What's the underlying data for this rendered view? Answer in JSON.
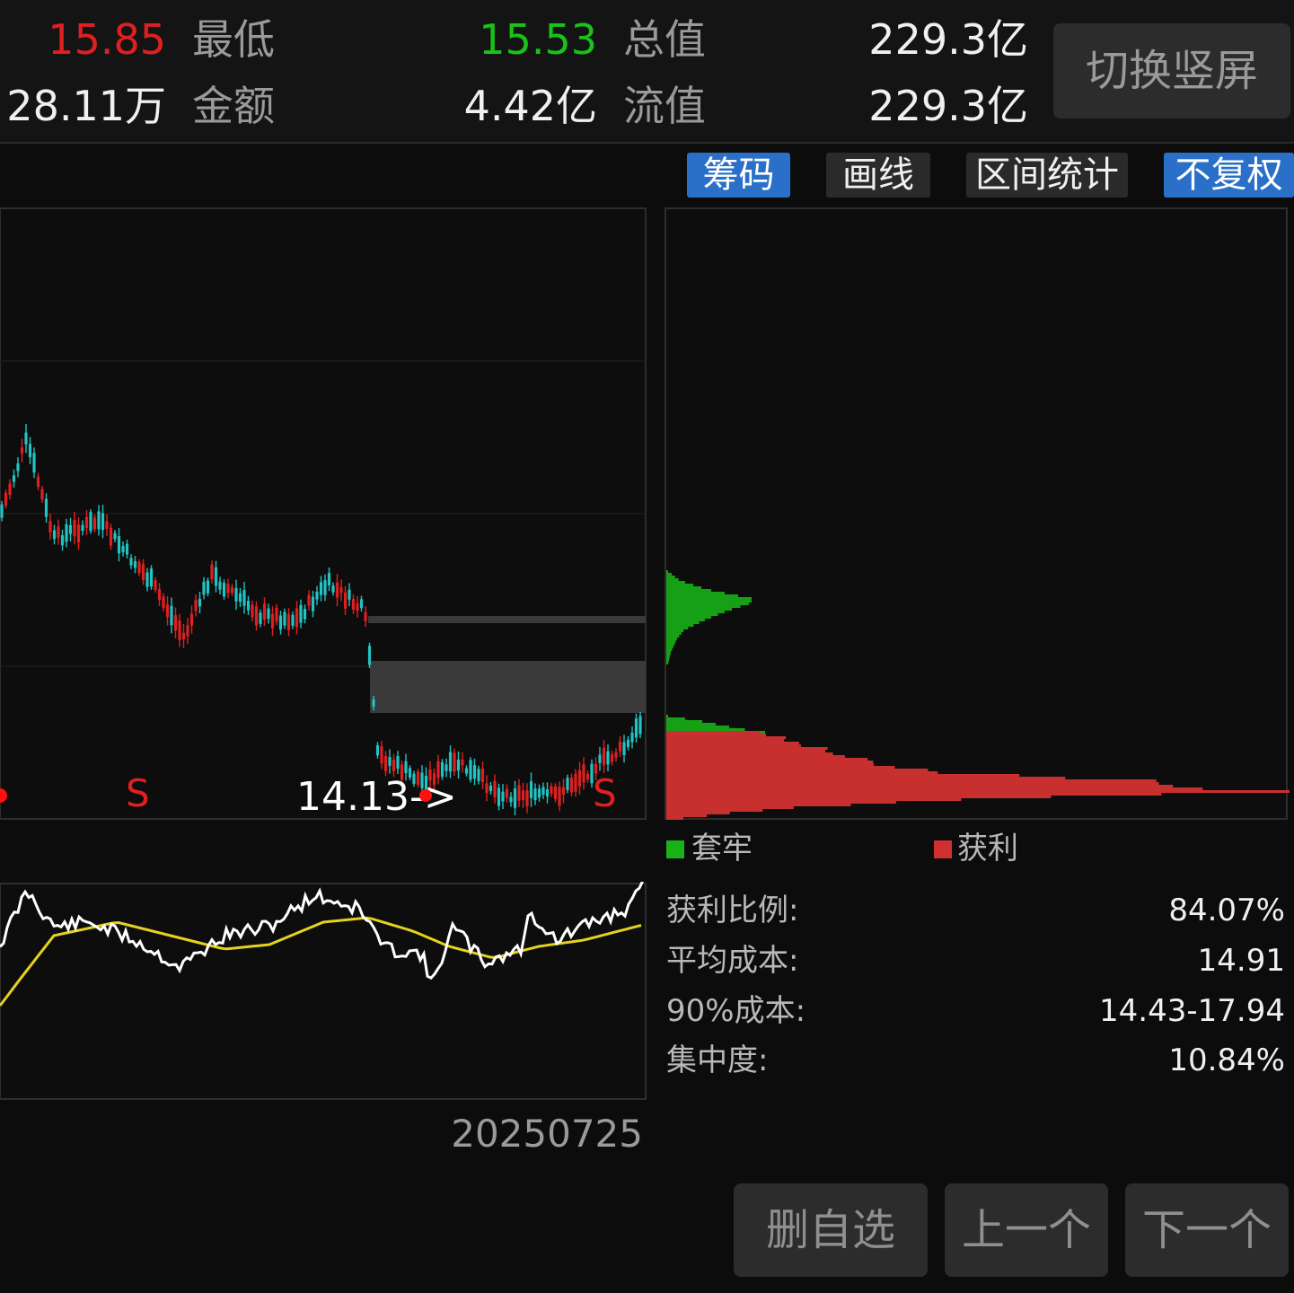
{
  "quote": {
    "row1": {
      "v1": "15.85",
      "l1": "最低",
      "v2": "15.53",
      "l2": "总值",
      "v3": "229.3亿"
    },
    "row2": {
      "v1": "28.11万",
      "l1": "金额",
      "v2": "4.42亿",
      "l2": "流值",
      "v3": "229.3亿"
    }
  },
  "switch_label": "切换竖屏",
  "toolbar": {
    "chips": "筹码",
    "draw": "画线",
    "range": "区间统计",
    "adjust": "不复权"
  },
  "kline": {
    "markers": {
      "s1": "S",
      "s2": "S",
      "price_tag": "14.13->"
    },
    "date": "20250725"
  },
  "legend": {
    "trapped": "套牢",
    "profit": "获利"
  },
  "stats": {
    "profit_ratio": {
      "label": "获利比例:",
      "value": "84.07%"
    },
    "avg_cost": {
      "label": "平均成本:",
      "value": "14.91"
    },
    "cost90": {
      "label": "90%成本:",
      "value": "14.43-17.94"
    },
    "concentration": {
      "label": "集中度:",
      "value": "10.84%"
    }
  },
  "bottom": {
    "delete": "删自选",
    "prev": "上一个",
    "next": "下一个"
  },
  "colors": {
    "up": "#e02020",
    "down": "#19c219",
    "candle_down": "#22c3c3",
    "accent": "#2a70c8",
    "ma": "#e6d21e"
  }
}
